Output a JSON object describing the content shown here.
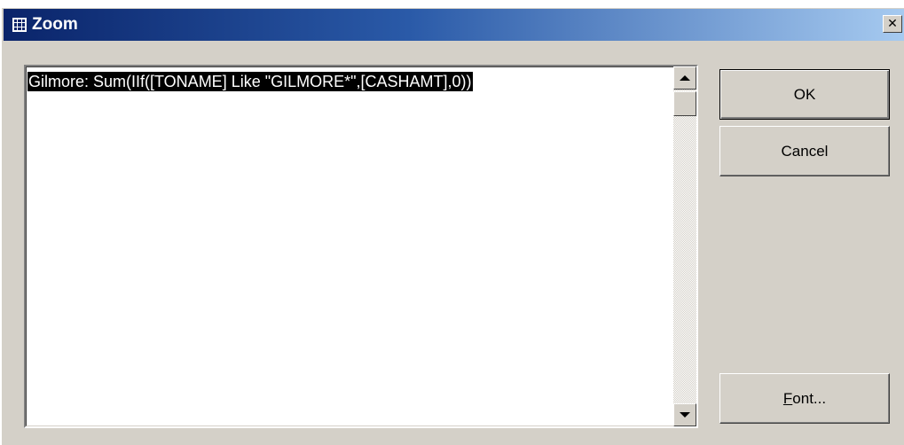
{
  "window": {
    "title": "Zoom",
    "close_glyph": "✕"
  },
  "editor": {
    "text": "Gilmore: Sum(IIf([TONAME] Like \"GILMORE*\",[CASHAMT],0))"
  },
  "buttons": {
    "ok_label": "OK",
    "cancel_label": "Cancel",
    "font_label": "Font...",
    "font_accelerator": "F",
    "font_rest": "ont..."
  },
  "colors": {
    "titlebar_start": "#0a246a",
    "titlebar_end": "#a6caf0",
    "face": "#d4d0c8",
    "selection_bg": "#000000"
  },
  "icons": {
    "system": "form-icon",
    "close": "close-icon",
    "scroll_up": "arrow-up-icon",
    "scroll_down": "arrow-down-icon"
  }
}
